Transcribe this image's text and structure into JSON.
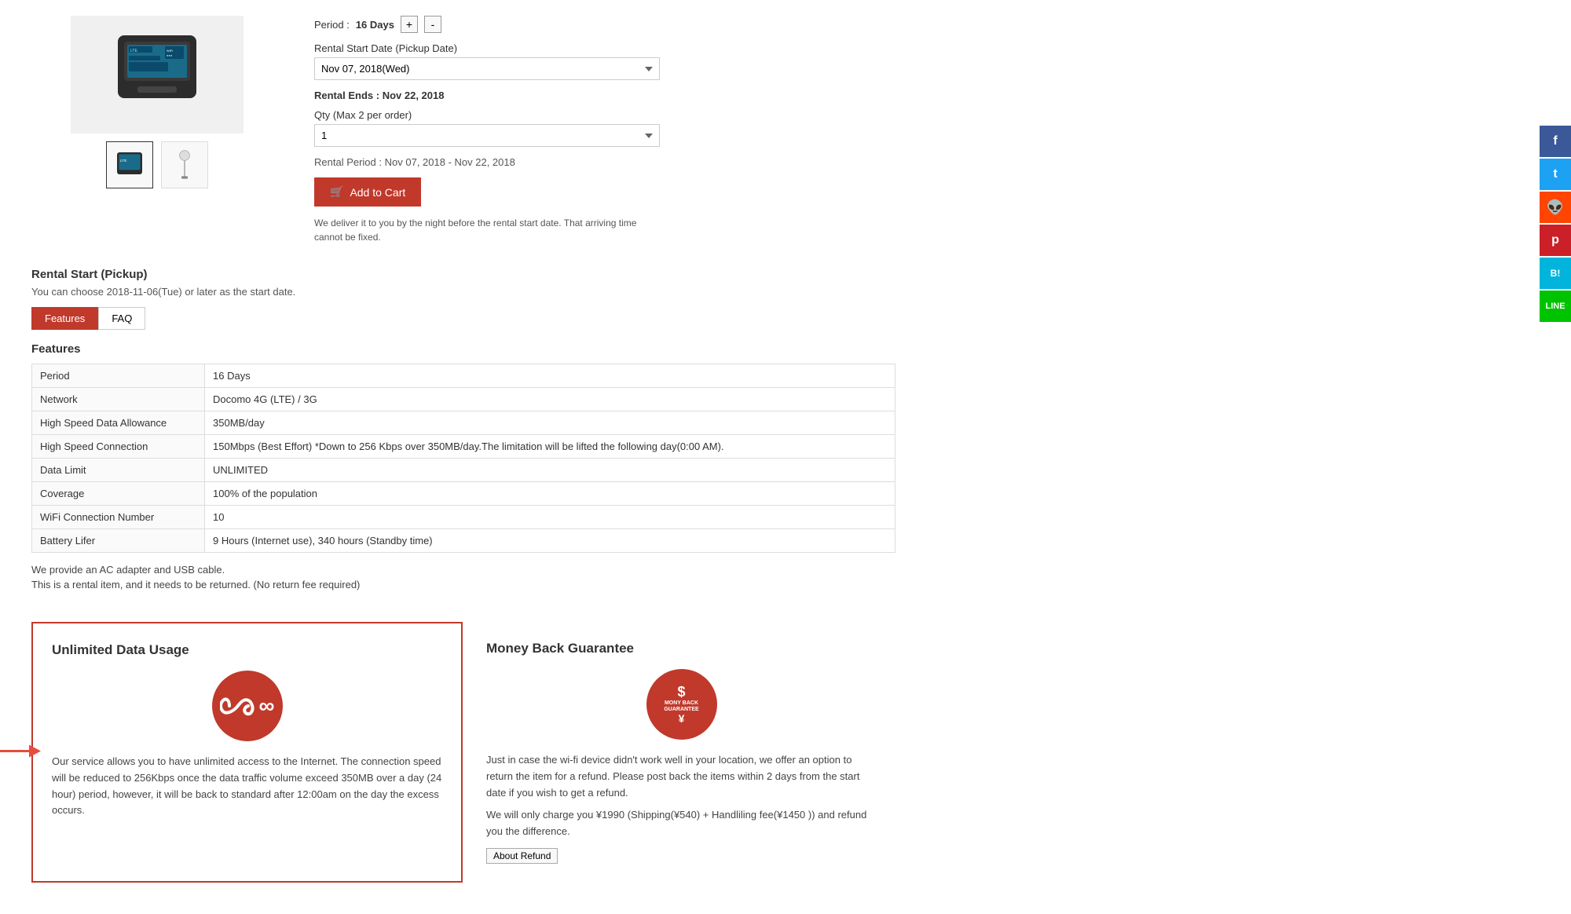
{
  "product": {
    "thumbnails": [
      "device-thumb",
      "cable-thumb"
    ]
  },
  "rental": {
    "period_label": "Period : 16 Days",
    "period_days": "16 Days",
    "start_date_label": "Rental Start Date (Pickup Date)",
    "start_date_value": "Nov 07, 2018(Wed)",
    "rental_ends_label": "Rental Ends :",
    "rental_ends_date": "Nov 22, 2018",
    "qty_label": "Qty (Max 2 per order)",
    "qty_value": "1",
    "rental_period_label": "Rental Period :",
    "rental_period_value": "Nov 07, 2018 - Nov 22, 2018",
    "add_to_cart": "Add to Cart",
    "delivery_note": "We deliver it to you by the night before the rental start date. That arriving time cannot be fixed."
  },
  "rental_start": {
    "title": "Rental Start (Pickup)",
    "subtitle": "You can choose 2018-11-06(Tue) or later as the start date."
  },
  "tabs": [
    {
      "label": "Features",
      "active": true
    },
    {
      "label": "FAQ",
      "active": false
    }
  ],
  "features": {
    "title": "Features",
    "rows": [
      {
        "label": "Period",
        "value": "16 Days"
      },
      {
        "label": "Network",
        "value": "Docomo 4G (LTE) / 3G"
      },
      {
        "label": "High Speed Data Allowance",
        "value": "350MB/day"
      },
      {
        "label": "High Speed Connection",
        "value": "150Mbps (Best Effort)\n*Down to 256 Kbps over 350MB/day.The limitation will be lifted the following day(0:00 AM)."
      },
      {
        "label": "Data Limit",
        "value": "UNLIMITED"
      },
      {
        "label": "Coverage",
        "value": "100% of the population"
      },
      {
        "label": "WiFi Connection Number",
        "value": "10"
      },
      {
        "label": "Battery Lifer",
        "value": "9 Hours (Internet use), 340 hours (Standby time)"
      }
    ],
    "note1": "We provide an AC adapter and USB cable.",
    "note2": "This is a rental item, and it needs to be returned. (No return fee required)"
  },
  "benefits": {
    "unlimited": {
      "title": "Unlimited Data Usage",
      "text": "Our service allows you to have unlimited access to the Internet. The connection speed will be reduced to 256Kbps once the data traffic volume exceed 350MB over a day (24 hour) period, however, it will be back to standard after 12:00am on the day the excess occurs."
    },
    "money_back": {
      "title": "Money Back Guarantee",
      "icon_line1": "$",
      "icon_line2": "MONY BACK",
      "icon_line3": "GUARANTEE",
      "icon_line4": "¥",
      "text1": "Just in case the wi-fi device didn't work well in your location, we offer an option to return the item for a refund. Please post back the items within 2 days from the start date if you wish to get a refund.",
      "text2": "We will only charge you ¥1990 (Shipping(¥540) + Handliling fee(¥1450 )) and refund you the difference.",
      "about_refund": "About Refund"
    }
  },
  "social": [
    {
      "label": "f",
      "name": "facebook"
    },
    {
      "label": "t",
      "name": "twitter"
    },
    {
      "label": "r",
      "name": "reddit"
    },
    {
      "label": "p",
      "name": "pocket"
    },
    {
      "label": "B!",
      "name": "hatena"
    },
    {
      "label": "✓",
      "name": "line"
    }
  ]
}
